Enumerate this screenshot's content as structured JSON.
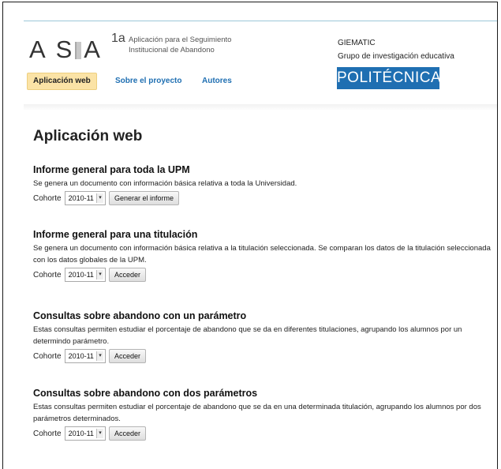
{
  "header": {
    "logo_text": "ASIA",
    "logo_sup": "1a",
    "logo_description": "Aplicación para el Seguimiento Institucional de Abandono",
    "org_name": "GIEMATIC",
    "org_subtitle": "Grupo de investigación educativa",
    "university_badge": "POLITÉCNICA"
  },
  "nav": {
    "items": [
      {
        "label": "Aplicación web",
        "active": true
      },
      {
        "label": "Sobre el proyecto",
        "active": false
      },
      {
        "label": "Autores",
        "active": false
      }
    ]
  },
  "main": {
    "title": "Aplicación web",
    "sections": [
      {
        "title": "Informe general para toda la UPM",
        "description": "Se genera un documento con información básica relativa a toda la Universidad.",
        "cohort_label": "Cohorte",
        "cohort_value": "2010-11",
        "button_label": "Generar el informe"
      },
      {
        "title": "Informe general para una titulación",
        "description": "Se genera un documento con información básica relativa a la titulación seleccionada. Se comparan los datos de la titulación seleccionada con los datos globales de la UPM.",
        "cohort_label": "Cohorte",
        "cohort_value": "2010-11",
        "button_label": "Acceder"
      },
      {
        "title": "Consultas sobre abandono con un parámetro",
        "description": "Estas consultas permiten estudiar el porcentaje de abandono que se da en diferentes titulaciones, agrupando los alumnos por un determindo parámetro.",
        "cohort_label": "Cohorte",
        "cohort_value": "2010-11",
        "button_label": "Acceder"
      },
      {
        "title": "Consultas sobre abandono con dos parámetros",
        "description": "Estas consultas permiten estudiar el porcentaje de abandono que se da en una determinada titulación, agrupando los alumnos por dos parámetros determinados.",
        "cohort_label": "Cohorte",
        "cohort_value": "2010-11",
        "button_label": "Acceder"
      }
    ]
  },
  "icons": {
    "select_arrow": "chevron-down-icon"
  },
  "colors": {
    "accent": "#1f6fb2",
    "active_tab_bg": "#fbe3a6"
  }
}
